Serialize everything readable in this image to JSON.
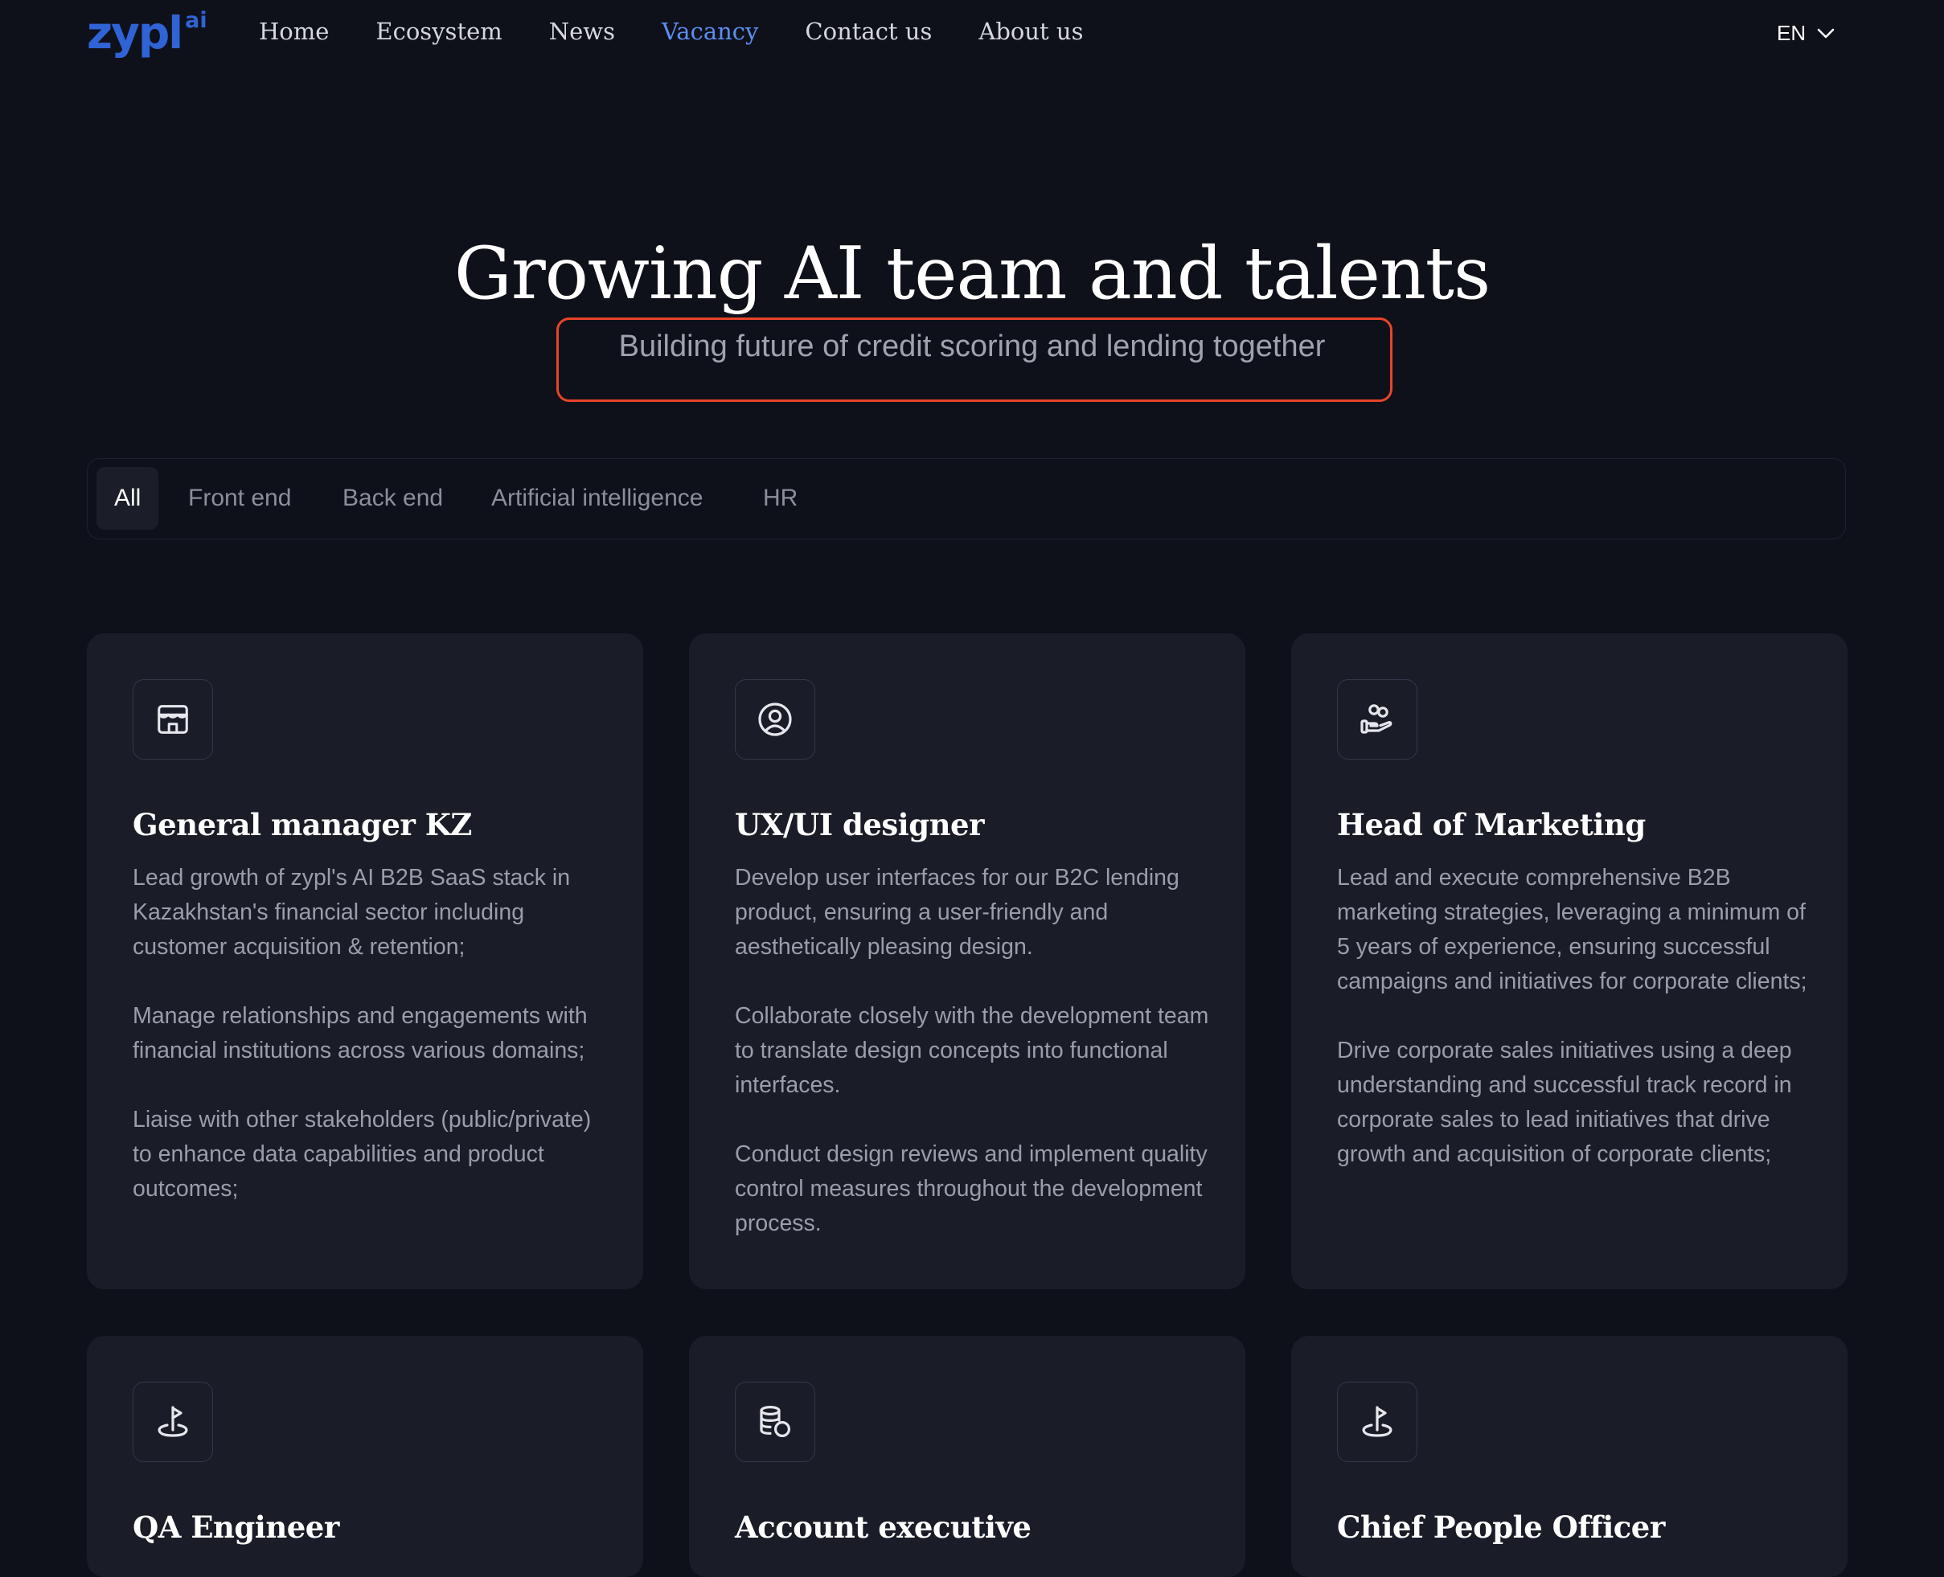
{
  "logo": {
    "main": "zypl",
    "sup": "ai"
  },
  "nav": [
    {
      "label": "Home",
      "active": false
    },
    {
      "label": "Ecosystem",
      "active": false
    },
    {
      "label": "News",
      "active": false
    },
    {
      "label": "Vacancy",
      "active": true
    },
    {
      "label": "Contact us",
      "active": false
    },
    {
      "label": "About us",
      "active": false
    }
  ],
  "language": {
    "selected": "EN",
    "icon": "chevron-down-icon"
  },
  "hero": {
    "title": "Growing AI team and talents",
    "subtitle": "Building future of credit scoring and lending together",
    "highlight_color": "#e8442a"
  },
  "filters": {
    "tabs": [
      "All",
      "Front end",
      "Back end",
      "Artificial intelligence",
      "HR"
    ],
    "selected": "All"
  },
  "vacancies": [
    {
      "title": "General manager KZ",
      "icon": "storefront-icon",
      "paragraphs": [
        "Lead growth of zypl's AI B2B SaaS stack in Kazakhstan's financial sector including customer acquisition & retention;",
        "Manage relationships and engagements with financial institutions across various domains;",
        "Liaise with other stakeholders (public/private) to enhance data capabilities and product outcomes;"
      ]
    },
    {
      "title": "UX/UI designer",
      "icon": "user-circle-icon",
      "paragraphs": [
        "Develop user interfaces for our B2C lending product, ensuring a user-friendly and aesthetically pleasing design.",
        "Collaborate closely with the development team to translate design concepts into functional interfaces.",
        "Conduct design reviews and implement quality control measures throughout the development process."
      ]
    },
    {
      "title": "Head of Marketing",
      "icon": "hand-coins-icon",
      "paragraphs": [
        "Lead and execute comprehensive B2B marketing strategies, leveraging a minimum of 5 years of experience, ensuring successful campaigns and initiatives for corporate clients;",
        "Drive corporate sales initiatives using a deep understanding and successful track record in corporate sales to lead initiatives that drive growth and acquisition of corporate clients;"
      ]
    },
    {
      "title": "QA Engineer",
      "icon": "flag-target-icon",
      "paragraphs": []
    },
    {
      "title": "Account executive",
      "icon": "database-coin-icon",
      "paragraphs": []
    },
    {
      "title": "Chief People Officer",
      "icon": "flag-target-icon",
      "paragraphs": []
    }
  ],
  "colors": {
    "background": "#0f111a",
    "card": "#1a1c27",
    "accent": "#5b8ef0",
    "brand": "#2f63d6"
  }
}
